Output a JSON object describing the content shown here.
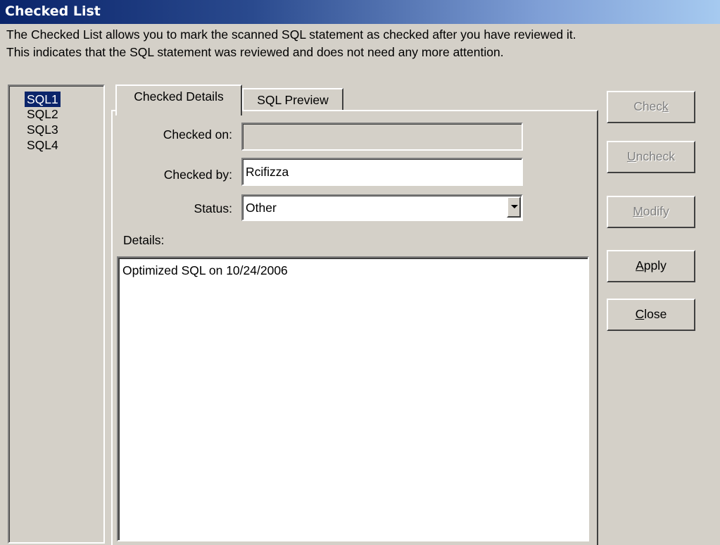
{
  "window": {
    "title": "Checked List"
  },
  "description": {
    "line1": "The Checked List allows you to mark the scanned SQL statement as checked after you have reviewed it.",
    "line2": "This indicates that the SQL statement was reviewed and does not need any more attention."
  },
  "sql_list": {
    "items": [
      "SQL1",
      "SQL2",
      "SQL3",
      "SQL4"
    ],
    "selected": "SQL1"
  },
  "tabs": {
    "active": "Checked Details",
    "inactive": "SQL Preview"
  },
  "form": {
    "checked_on_label": "Checked on:",
    "checked_on_value": "",
    "checked_by_label": "Checked by:",
    "checked_by_value": "Rcifizza",
    "status_label": "Status:",
    "status_value": "Other",
    "details_label": "Details:",
    "details_value": "Optimized SQL on 10/24/2006"
  },
  "buttons": {
    "check": {
      "pre": "Chec",
      "key": "k",
      "post": "",
      "enabled": false
    },
    "uncheck": {
      "pre": "",
      "key": "U",
      "post": "ncheck",
      "enabled": false
    },
    "modify": {
      "pre": "",
      "key": "M",
      "post": "odify",
      "enabled": false
    },
    "apply": {
      "pre": "",
      "key": "A",
      "post": "pply",
      "enabled": true
    },
    "close": {
      "pre": "",
      "key": "C",
      "post": "lose",
      "enabled": true
    }
  },
  "icons": {
    "status_dropdown": "chevron-down-icon"
  }
}
